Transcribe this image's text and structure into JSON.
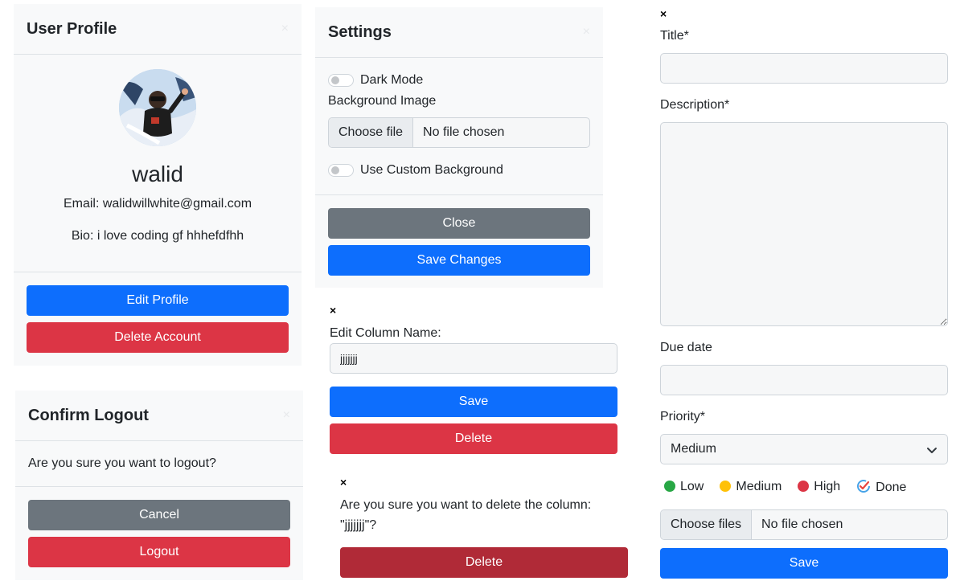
{
  "profile": {
    "title": "User Profile",
    "close_glyph": "×",
    "name": "walid",
    "email_text": "Email: walidwillwhite@gmail.com",
    "bio_text": "Bio: i love coding gf hhhefdfhh",
    "edit_label": "Edit Profile",
    "delete_label": "Delete Account"
  },
  "logout": {
    "title": "Confirm Logout",
    "close_glyph": "×",
    "message": "Are you sure you want to logout?",
    "cancel_label": "Cancel",
    "logout_label": "Logout"
  },
  "settings": {
    "title": "Settings",
    "close_glyph": "×",
    "dark_mode_label": "Dark Mode",
    "bg_image_label": "Background Image",
    "choose_file_label": "Choose file",
    "no_file_text": "No file chosen",
    "custom_bg_label": "Use Custom Background",
    "close_label": "Close",
    "save_label": "Save Changes"
  },
  "edit_column": {
    "close_glyph": "×",
    "label": "Edit Column Name:",
    "value": "jjjjjjj",
    "save_label": "Save",
    "delete_label": "Delete"
  },
  "delete_column": {
    "close_glyph": "×",
    "message_line1": "Are you sure you want to delete the column:",
    "message_line2": "\"jjjjjjj\"?",
    "delete_label": "Delete"
  },
  "task_form": {
    "close_glyph": "×",
    "title_label": "Title*",
    "description_label": "Description*",
    "due_label": "Due date",
    "priority_label": "Priority*",
    "priority_value": "Medium",
    "legend": [
      {
        "label": "Low",
        "color": "#28a745"
      },
      {
        "label": "Medium",
        "color": "#ffc107"
      },
      {
        "label": "High",
        "color": "#dc3545"
      },
      {
        "label": "Done",
        "icon": "done-check-icon"
      }
    ],
    "choose_files_label": "Choose files",
    "no_file_text": "No file chosen",
    "save_label": "Save"
  }
}
